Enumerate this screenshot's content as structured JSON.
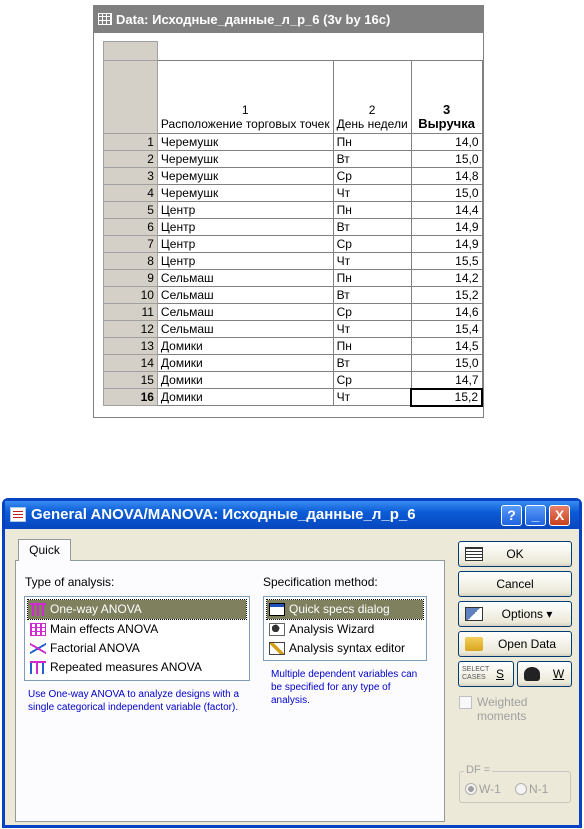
{
  "sheet": {
    "title": "Data: Исходные_данные_л_р_6 (3v by 16c)",
    "columns": [
      {
        "num": "1",
        "name": "Расположение торговых точек"
      },
      {
        "num": "2",
        "name": "День недели"
      },
      {
        "num": "3",
        "name": "Выручка"
      }
    ],
    "rows": [
      {
        "n": "1",
        "loc": "Черемушк",
        "day": "Пн",
        "rev": "14,0"
      },
      {
        "n": "2",
        "loc": "Черемушк",
        "day": "Вт",
        "rev": "15,0"
      },
      {
        "n": "3",
        "loc": "Черемушк",
        "day": "Ср",
        "rev": "14,8"
      },
      {
        "n": "4",
        "loc": "Черемушк",
        "day": "Чт",
        "rev": "15,0"
      },
      {
        "n": "5",
        "loc": "Центр",
        "day": "Пн",
        "rev": "14,4"
      },
      {
        "n": "6",
        "loc": "Центр",
        "day": "Вт",
        "rev": "14,9"
      },
      {
        "n": "7",
        "loc": "Центр",
        "day": "Ср",
        "rev": "14,9"
      },
      {
        "n": "8",
        "loc": "Центр",
        "day": "Чт",
        "rev": "15,5"
      },
      {
        "n": "9",
        "loc": "Сельмаш",
        "day": "Пн",
        "rev": "14,2"
      },
      {
        "n": "10",
        "loc": "Сельмаш",
        "day": "Вт",
        "rev": "15,2"
      },
      {
        "n": "11",
        "loc": "Сельмаш",
        "day": "Ср",
        "rev": "14,6"
      },
      {
        "n": "12",
        "loc": "Сельмаш",
        "day": "Чт",
        "rev": "15,4"
      },
      {
        "n": "13",
        "loc": "Домики",
        "day": "Пн",
        "rev": "14,5"
      },
      {
        "n": "14",
        "loc": "Домики",
        "day": "Вт",
        "rev": "15,0"
      },
      {
        "n": "15",
        "loc": "Домики",
        "day": "Ср",
        "rev": "14,7"
      },
      {
        "n": "16",
        "loc": "Домики",
        "day": "Чт",
        "rev": "15,2"
      }
    ]
  },
  "dialog": {
    "title": "General ANOVA/MANOVA: Исходные_данные_л_р_6",
    "help": "?",
    "minimize": "_",
    "close": "X",
    "tab": "Quick",
    "type_label": "Type of analysis:",
    "analysis_types": [
      "One-way ANOVA",
      "Main effects ANOVA",
      "Factorial ANOVA",
      "Repeated measures ANOVA"
    ],
    "spec_label": "Specification method:",
    "spec_methods": [
      "Quick specs dialog",
      "Analysis Wizard",
      "Analysis syntax editor"
    ],
    "note_left": "Use One-way ANOVA to analyze designs with a single categorical independent variable (factor).",
    "note_right": "Multiple dependent variables can be specified for any type of analysis.",
    "buttons": {
      "ok": "OK",
      "cancel": "Cancel",
      "options": "Options ▾",
      "open_data": "Open Data",
      "select_cases": "SELECT CASES",
      "s": "S",
      "w": "W"
    },
    "weighted": "Weighted moments",
    "df_label": "DF =",
    "df_options": [
      "W-1",
      "N-1"
    ],
    "df_selected": "W-1",
    "icons": [
      "grid-icon",
      "anova-app-icon",
      "help-icon",
      "minimize-icon",
      "close-icon",
      "ok-icon",
      "options-icon",
      "open-folder-icon",
      "weight-icon"
    ]
  }
}
